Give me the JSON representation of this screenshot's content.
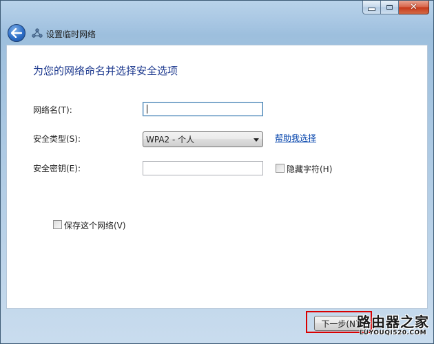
{
  "window": {
    "caption_buttons": {
      "close": "✕"
    }
  },
  "nav": {
    "title": "设置临时网络"
  },
  "form": {
    "heading": "为您的网络命名并选择安全选项",
    "network_name_label": "网络名(T):",
    "network_name_value": "",
    "security_type_label": "安全类型(S):",
    "security_type_value": "WPA2 - 个人",
    "help_link": "帮助我选择",
    "security_key_label": "安全密钥(E):",
    "security_key_value": "",
    "hide_chars_label": "隐藏字符(H)",
    "hide_chars_checked": false,
    "save_network_label": "保存这个网络(V)",
    "save_network_checked": false
  },
  "footer": {
    "next_button": "下一步(N)",
    "highlight_color": "#d90000"
  },
  "watermark": {
    "main": "路由器之家",
    "sub": "LUYOUQI520.COM"
  },
  "colors": {
    "heading": "#1e3a8f",
    "link": "#0645ad",
    "frame": "#a6c5e2"
  },
  "icons": {
    "back": "back-arrow-icon",
    "network": "network-icon",
    "minimize": "minimize-icon",
    "maximize": "maximize-icon",
    "close": "close-icon",
    "dropdown": "chevron-down-icon"
  }
}
